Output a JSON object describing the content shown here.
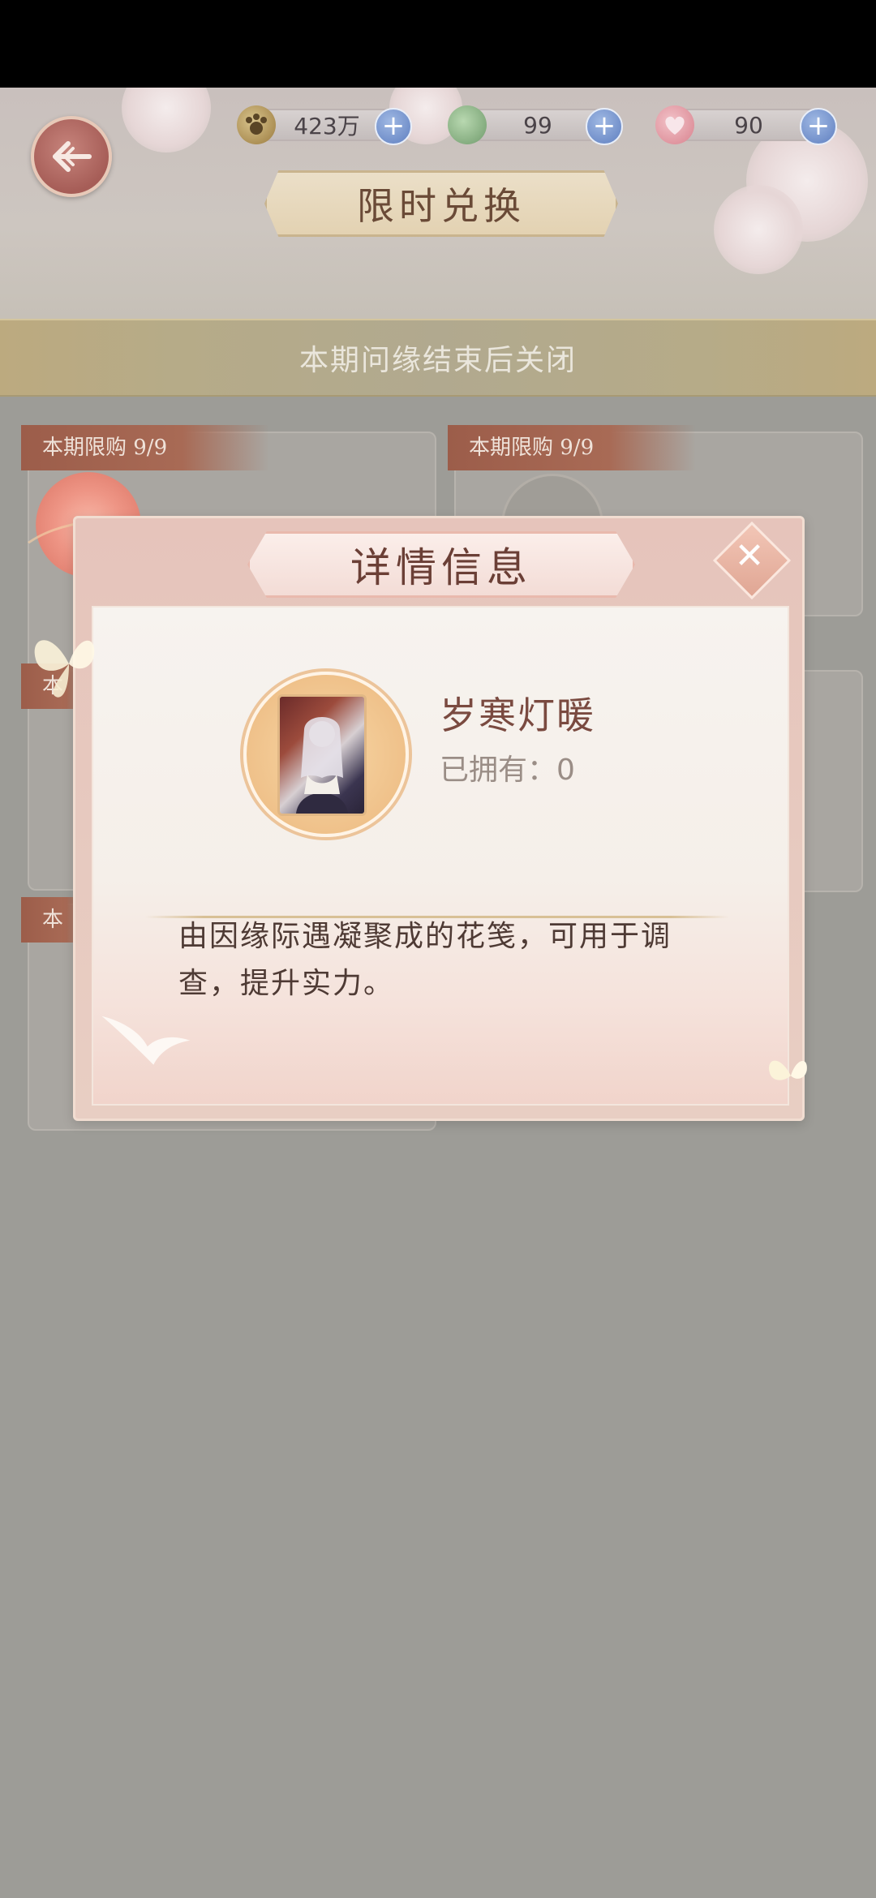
{
  "header": {
    "title": "限时兑换",
    "back_icon": "back-arrow-icon"
  },
  "currencies": [
    {
      "name": "paw-coin",
      "icon": "paw-coin-icon",
      "value": "423万"
    },
    {
      "name": "jade-token",
      "icon": "jade-token-icon",
      "value": "99"
    },
    {
      "name": "heart-token",
      "icon": "heart-token-icon",
      "value": "90"
    }
  ],
  "notice": "本期问缘结束后关闭",
  "shop_cards": [
    {
      "tag": "本期限购 9/9"
    },
    {
      "tag": "本期限购 9/9"
    },
    {
      "tag": "本"
    },
    {
      "tag": "本"
    }
  ],
  "modal": {
    "title": "详情信息",
    "item_name": "岁寒灯暖",
    "owned_label": "已拥有：0",
    "description": "由因缘际遇凝聚成的花笺，可用于调查，提升实力。",
    "close_icon": "close-icon"
  },
  "colors": {
    "accent": "#a65d57",
    "overlay": "#9d9c97",
    "modal_title_text": "#6b3f36"
  }
}
